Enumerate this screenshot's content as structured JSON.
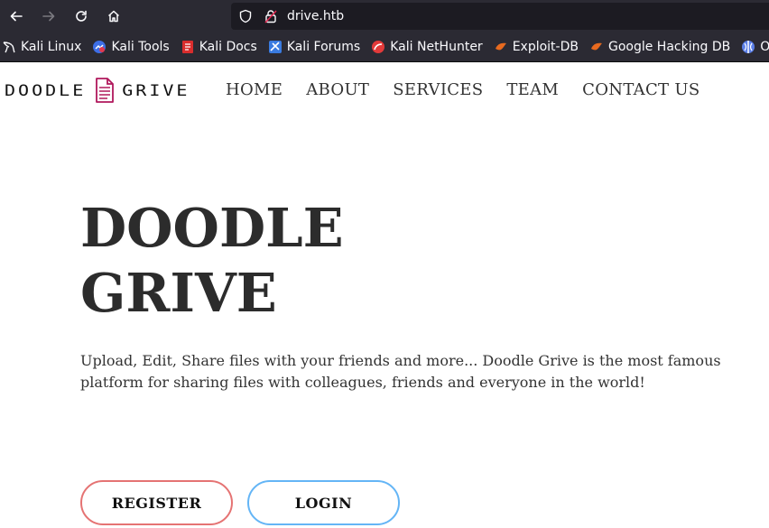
{
  "browser": {
    "url": "drive.htb",
    "bookmarks": [
      {
        "label": "Kali Linux",
        "icon": "kali-dragon-icon"
      },
      {
        "label": "Kali Tools",
        "icon": "kali-tools-icon"
      },
      {
        "label": "Kali Docs",
        "icon": "kali-docs-icon"
      },
      {
        "label": "Kali Forums",
        "icon": "kali-forums-icon"
      },
      {
        "label": "Kali NetHunter",
        "icon": "nethunter-icon"
      },
      {
        "label": "Exploit-DB",
        "icon": "exploit-db-icon"
      },
      {
        "label": "Google Hacking DB",
        "icon": "ghdb-icon"
      },
      {
        "label": "OffSec",
        "icon": "offsec-icon"
      }
    ]
  },
  "site": {
    "logo": {
      "left": "DOODLE",
      "right": "GRIVE"
    },
    "nav": [
      "HOME",
      "ABOUT",
      "SERVICES",
      "TEAM",
      "CONTACT US"
    ],
    "hero": {
      "title_line1": "DOODLE",
      "title_line2": "GRIVE",
      "text": "Upload, Edit, Share files with your friends and more... Doodle Grive is the most famous platform for sharing files with colleagues, friends and everyone in the world!",
      "register_label": "REGISTER",
      "login_label": "LOGIN"
    }
  },
  "colors": {
    "chrome_bg": "#2b2a33",
    "url_bg": "#1c1b22",
    "register_border": "#e57373",
    "login_border": "#64b5f6",
    "logo_accent": "#b0185c"
  }
}
